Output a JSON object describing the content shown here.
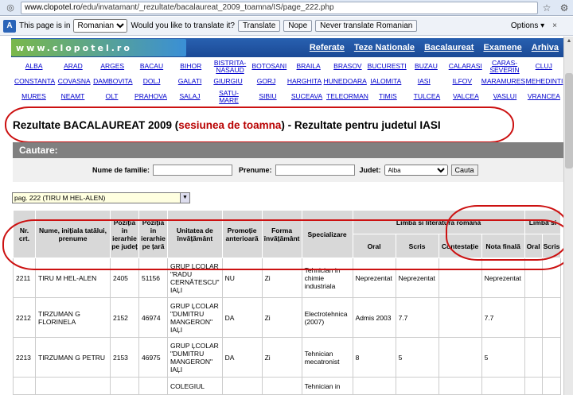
{
  "browser": {
    "url_host": "www.clopotel.ro",
    "url_path": "/edu/invatamant/_rezultate/bacalaureat_2009_toamna/IS/page_222.php"
  },
  "translate_bar": {
    "label": "This page is in",
    "language": "Romanian",
    "question": "Would you like to translate it?",
    "translate_btn": "Translate",
    "nope_btn": "Nope",
    "never_btn": "Never translate Romanian",
    "options": "Options",
    "close": "×"
  },
  "site": {
    "logo": "www.clopotel.ro",
    "menu": [
      "Referate",
      "Teze Nationale",
      "Bacalaureat",
      "Examene",
      "Arhiva"
    ]
  },
  "counties": [
    [
      "ALBA",
      "ARAD",
      "ARGES",
      "BACAU",
      "BIHOR",
      "BISTRITA-NASAUD",
      "BOTOSANI",
      "BRAILA",
      "BRASOV",
      "BUCURESTI",
      "BUZAU",
      "CALARASI",
      "CARAS-SEVERIN",
      "CLUJ"
    ],
    [
      "CONSTANTA",
      "COVASNA",
      "DAMBOVITA",
      "DOLJ",
      "GALATI",
      "GIURGIU",
      "GORJ",
      "HARGHITA",
      "HUNEDOARA",
      "IALOMITA",
      "IASI",
      "ILFOV",
      "MARAMURES",
      "MEHEDINTI"
    ],
    [
      "MURES",
      "NEAMT",
      "OLT",
      "PRAHOVA",
      "SALAJ",
      "SATU-MARE",
      "SIBIU",
      "SUCEAVA",
      "TELEORMAN",
      "TIMIS",
      "TULCEA",
      "VALCEA",
      "VASLUI",
      "VRANCEA"
    ]
  ],
  "title": {
    "part1": "Rezultate BACALAUREAT 2009 (",
    "part2": "sesiunea de toamna",
    "part3": ") - Rezultate pentru judetul IASI"
  },
  "search": {
    "heading": "Cautare:",
    "surname_label": "Nume de familie:",
    "firstname_label": "Prenume:",
    "county_label": "Judet:",
    "county_value": "Alba",
    "button": "Cauta"
  },
  "page_select": "pag. 222 (TIRU M HEL-ALEN)",
  "table": {
    "headers": {
      "nr": "Nr. crt.",
      "name": "Nume, inițiala tatălui, prenume",
      "pos_county": "Poziția in ierarhie pe județ",
      "pos_country": "Poziția in ierarhie pe țară",
      "unit": "Unitatea de învățământ",
      "promo": "Promoție anterioară",
      "form": "Forma învățământ",
      "spec": "Specializare",
      "lit": "Limba si literatura română",
      "lit2": "Limba si",
      "oral": "Oral",
      "scris": "Scris",
      "contest": "Contestație",
      "final": "Nota finală",
      "oral2": "Oral",
      "scris2": "Scris"
    },
    "rows": [
      {
        "nr": "2211",
        "name": "TIRU M HEL-ALEN",
        "pc": "2405",
        "pt": "51156",
        "unit": "GRUP ĻCOLAR \"RADU CERNĂTESCU\" IAĻI",
        "promo": "NU",
        "form": "Zi",
        "spec": "Tehnician in chimie industriala",
        "oral": "Neprezentat",
        "scris": "Neprezentat",
        "contest": "",
        "final": "Neprezentat"
      },
      {
        "nr": "2212",
        "name": "TIRZUMAN G FLORINELA",
        "pc": "2152",
        "pt": "46974",
        "unit": "GRUP ĻCOLAR \"DUMITRU MANGERON\" IAĻI",
        "promo": "DA",
        "form": "Zi",
        "spec": "Electrotehnica (2007)",
        "oral": "Admis 2003",
        "scris": "7.7",
        "contest": "",
        "final": "7.7"
      },
      {
        "nr": "2213",
        "name": "TIRZUMAN G PETRU",
        "pc": "2153",
        "pt": "46975",
        "unit": "GRUP ĻCOLAR \"DUMITRU MANGERON\" IAĻI",
        "promo": "DA",
        "form": "Zi",
        "spec": "Tehnician mecatronist",
        "oral": "8",
        "scris": "5",
        "contest": "",
        "final": "5"
      },
      {
        "nr": "",
        "name": "",
        "pc": "",
        "pt": "",
        "unit": "COLEGIUL",
        "promo": "",
        "form": "",
        "spec": "Tehnician in",
        "oral": "",
        "scris": "",
        "contest": "",
        "final": ""
      }
    ]
  }
}
